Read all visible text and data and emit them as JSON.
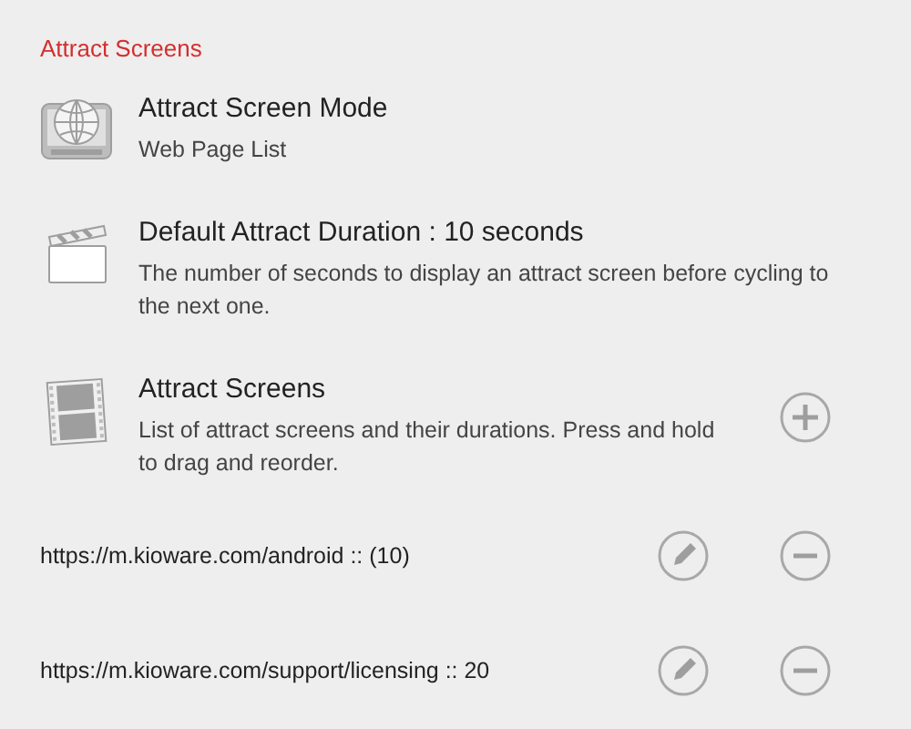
{
  "section_title": "Attract Screens",
  "settings": [
    {
      "kind": "mode",
      "title": "Attract Screen Mode",
      "summary": "Web Page List"
    },
    {
      "kind": "duration",
      "title": "Default Attract Duration : 10 seconds",
      "summary": "The number of seconds to display an attract screen before cycling to the next one."
    },
    {
      "kind": "list",
      "title": "Attract Screens",
      "summary": "List of attract screens and their durations. Press and hold to drag and reorder.",
      "add_button": true
    }
  ],
  "entries": [
    {
      "text": "https://m.kioware.com/android :: (10)"
    },
    {
      "text": "https://m.kioware.com/support/licensing :: 20"
    }
  ]
}
